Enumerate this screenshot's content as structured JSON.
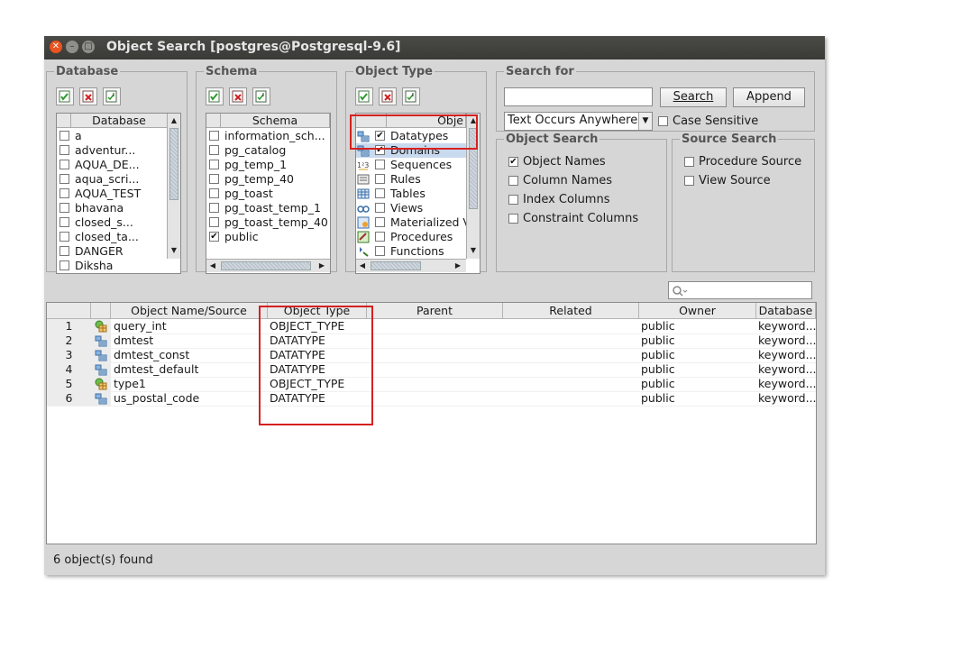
{
  "window": {
    "title": "Object Search [postgres@Postgresql-9.6]"
  },
  "database_group": {
    "legend": "Database",
    "header": "Database",
    "items": [
      {
        "label": "a",
        "checked": false
      },
      {
        "label": "adventur...",
        "checked": false
      },
      {
        "label": "AQUA_DE...",
        "checked": false
      },
      {
        "label": "aqua_scri...",
        "checked": false
      },
      {
        "label": "AQUA_TEST",
        "checked": false
      },
      {
        "label": "bhavana",
        "checked": false
      },
      {
        "label": "closed_s...",
        "checked": false
      },
      {
        "label": "closed_ta...",
        "checked": false
      },
      {
        "label": "DANGER",
        "checked": false
      },
      {
        "label": "Diksha",
        "checked": false
      }
    ]
  },
  "schema_group": {
    "legend": "Schema",
    "header": "Schema",
    "items": [
      {
        "label": "information_sch...",
        "checked": false
      },
      {
        "label": "pg_catalog",
        "checked": false
      },
      {
        "label": "pg_temp_1",
        "checked": false
      },
      {
        "label": "pg_temp_40",
        "checked": false
      },
      {
        "label": "pg_toast",
        "checked": false
      },
      {
        "label": "pg_toast_temp_1",
        "checked": false
      },
      {
        "label": "pg_toast_temp_40",
        "checked": false
      },
      {
        "label": "public",
        "checked": true
      }
    ]
  },
  "object_type_group": {
    "legend": "Object Type",
    "header": "Obje",
    "items": [
      {
        "label": "Datatypes",
        "checked": true,
        "icon": "datatype-icon"
      },
      {
        "label": "Domains",
        "checked": true,
        "icon": "domain-icon",
        "selected": true
      },
      {
        "label": "Sequences",
        "checked": false,
        "icon": "sequence-icon"
      },
      {
        "label": "Rules",
        "checked": false,
        "icon": "rule-icon"
      },
      {
        "label": "Tables",
        "checked": false,
        "icon": "table-icon"
      },
      {
        "label": "Views",
        "checked": false,
        "icon": "view-icon"
      },
      {
        "label": "Materialized V",
        "checked": false,
        "icon": "materialized-view-icon"
      },
      {
        "label": "Procedures",
        "checked": false,
        "icon": "procedure-icon"
      },
      {
        "label": "Functions",
        "checked": false,
        "icon": "function-icon"
      }
    ]
  },
  "search_for": {
    "legend": "Search for",
    "value": "",
    "search_button": "Search",
    "append_button": "Append",
    "mode": "Text Occurs Anywhere",
    "case_sensitive_label": "Case Sensitive",
    "case_sensitive": false
  },
  "object_search": {
    "legend": "Object Search",
    "options": [
      {
        "label": "Object Names",
        "checked": true
      },
      {
        "label": "Column Names",
        "checked": false
      },
      {
        "label": "Index Columns",
        "checked": false
      },
      {
        "label": "Constraint Columns",
        "checked": false
      }
    ]
  },
  "source_search": {
    "legend": "Source Search",
    "options": [
      {
        "label": "Procedure Source",
        "checked": false
      },
      {
        "label": "View Source",
        "checked": false
      }
    ]
  },
  "results": {
    "columns": [
      "Object Name/Source",
      "Object Type",
      "Parent",
      "Related",
      "Owner",
      "Database"
    ],
    "rows": [
      {
        "num": "1",
        "icon": "object-type-icon",
        "name": "query_int",
        "type": "OBJECT_TYPE",
        "parent": "",
        "related": "",
        "owner": "public",
        "database": "keyword..."
      },
      {
        "num": "2",
        "icon": "datatype-icon",
        "name": "dmtest",
        "type": "DATATYPE",
        "parent": "",
        "related": "",
        "owner": "public",
        "database": "keyword..."
      },
      {
        "num": "3",
        "icon": "datatype-icon",
        "name": "dmtest_const",
        "type": "DATATYPE",
        "parent": "",
        "related": "",
        "owner": "public",
        "database": "keyword..."
      },
      {
        "num": "4",
        "icon": "datatype-icon",
        "name": "dmtest_default",
        "type": "DATATYPE",
        "parent": "",
        "related": "",
        "owner": "public",
        "database": "keyword..."
      },
      {
        "num": "5",
        "icon": "object-type-icon",
        "name": "type1",
        "type": "OBJECT_TYPE",
        "parent": "",
        "related": "",
        "owner": "public",
        "database": "keyword..."
      },
      {
        "num": "6",
        "icon": "datatype-icon",
        "name": "us_postal_code",
        "type": "DATATYPE",
        "parent": "",
        "related": "",
        "owner": "public",
        "database": "keyword..."
      }
    ]
  },
  "status": "6 object(s) found",
  "colors": {
    "highlight": "#d62020",
    "selection": "#c9d9ee",
    "titlebar": "#3c3b37"
  }
}
